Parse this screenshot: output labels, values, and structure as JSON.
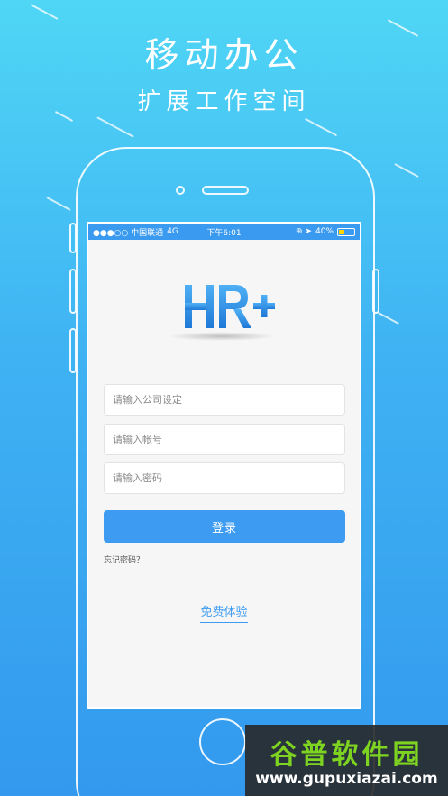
{
  "promo": {
    "title": "移动办公",
    "subtitle": "扩展工作空间"
  },
  "status_bar": {
    "carrier": "●●●○○ 中国联通",
    "network": "4G",
    "time": "下午6:01",
    "icons": "⊕ ➤",
    "battery_text": "40%",
    "battery_level": 0.4
  },
  "app": {
    "logo_text": "HR+"
  },
  "form": {
    "company_placeholder": "请输入公司设定",
    "account_placeholder": "请输入帐号",
    "password_placeholder": "请输入密码",
    "login_label": "登录",
    "forgot_label": "忘记密码？",
    "trial_label": "免费体验"
  },
  "watermark": {
    "brand": "谷普软件园",
    "url": "www.gupuxiazai.com"
  },
  "colors": {
    "accent": "#3d9cf2",
    "background_top": "#4fd6f5",
    "background_bottom": "#3399ee",
    "watermark_green": "#7ed321"
  }
}
